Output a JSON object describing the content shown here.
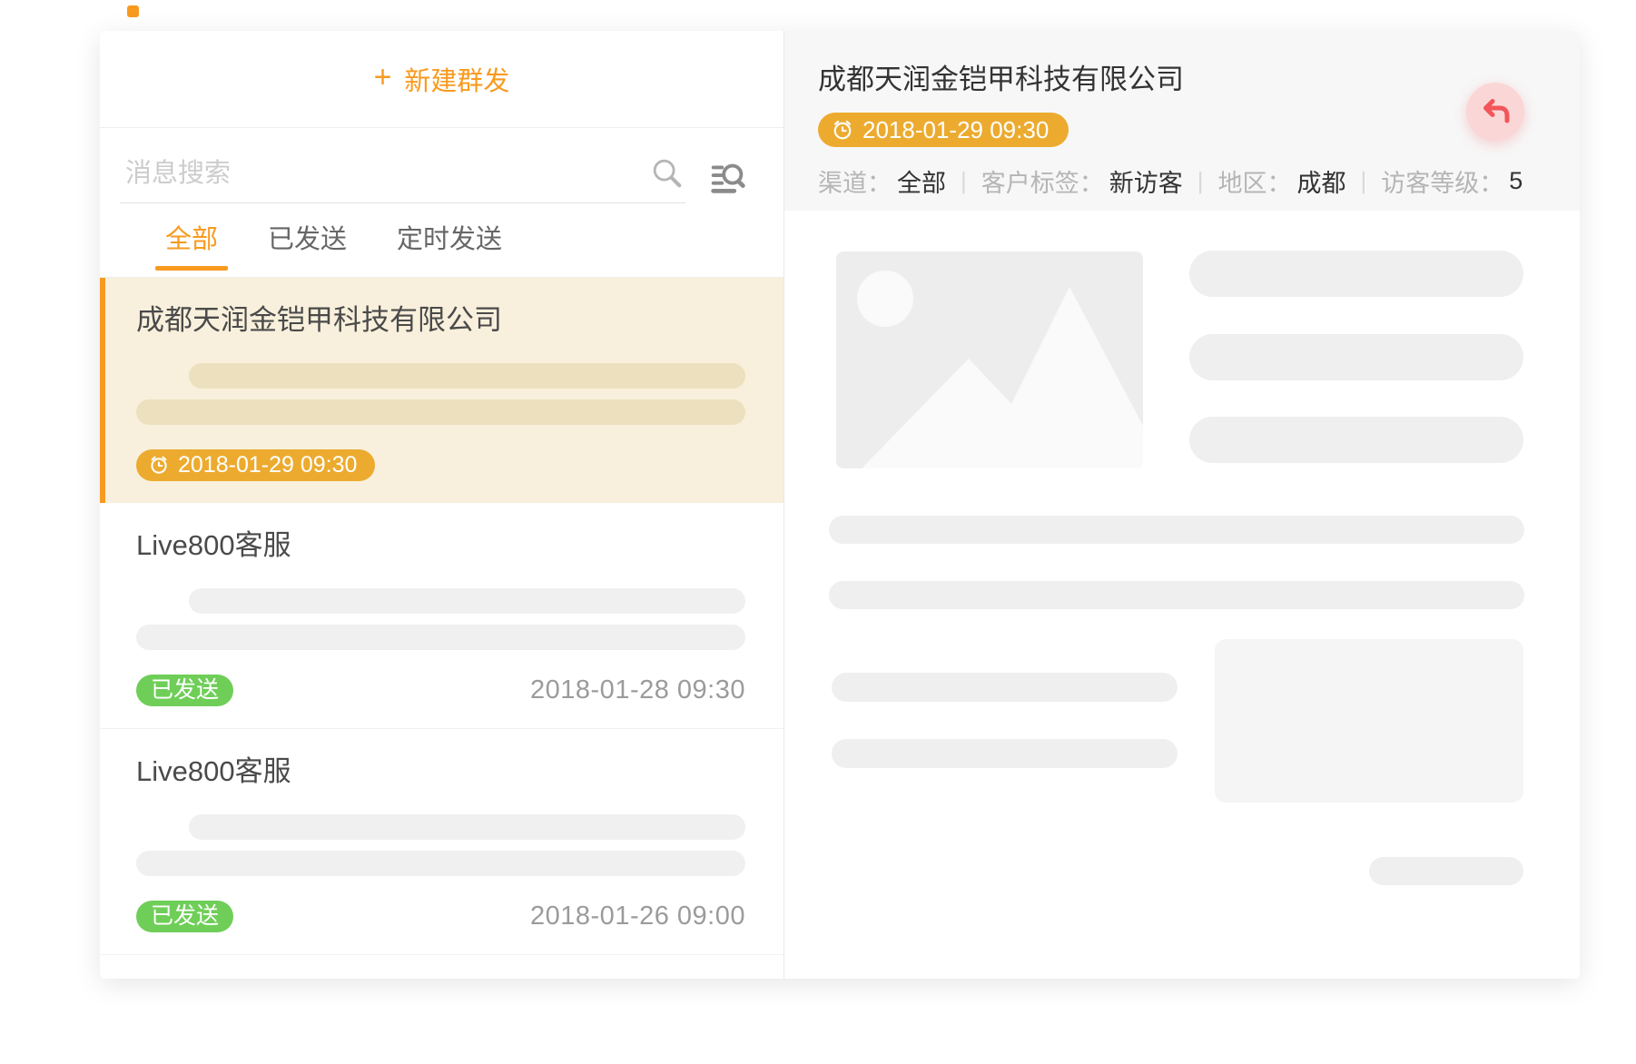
{
  "colors": {
    "accent_orange": "#F89A1F",
    "badge_orange": "#ECAB2F",
    "selected_item_bg": "#F8F0DC",
    "selected_item_bar": "#EDE0BE",
    "sent_green": "#6FCE58",
    "return_button_bg": "#FBD6D6",
    "return_arrow_red": "#F2555A",
    "header_gray": "#F7F7F7",
    "placeholder_gray": "#EFEFF0"
  },
  "left_panel": {
    "new_broadcast": {
      "icon": "+",
      "label": "新建群发"
    },
    "search": {
      "placeholder": "消息搜索"
    },
    "tabs": [
      {
        "label": "全部",
        "active": true
      },
      {
        "label": "已发送",
        "active": false
      },
      {
        "label": "定时发送",
        "active": false
      }
    ],
    "items": [
      {
        "title": "成都天润金铠甲科技有限公司",
        "selected": true,
        "schedule_badge": "2018-01-29 09:30"
      },
      {
        "title": "Live800客服",
        "selected": false,
        "status_badge": "已发送",
        "date": "2018-01-28 09:30"
      },
      {
        "title": "Live800客服",
        "selected": false,
        "status_badge": "已发送",
        "date": "2018-01-26 09:00"
      }
    ]
  },
  "right_panel": {
    "title": "成都天润金铠甲科技有限公司",
    "schedule_badge": "2018-01-29  09:30",
    "separator": "|",
    "meta": [
      {
        "label": "渠道：",
        "value": "全部"
      },
      {
        "label": "客户标签：",
        "value": "新访客"
      },
      {
        "label": "地区：",
        "value": "成都"
      },
      {
        "label": "访客等级：",
        "value": "5"
      }
    ]
  }
}
